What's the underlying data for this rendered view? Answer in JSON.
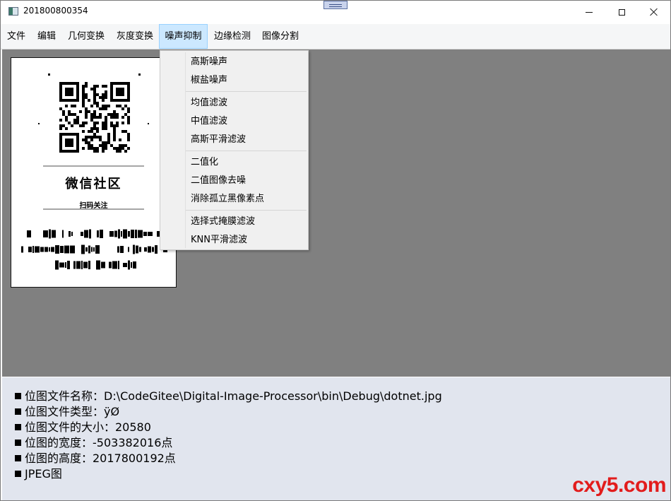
{
  "window": {
    "title": "201800800354"
  },
  "menubar": {
    "items": [
      {
        "label": "文件"
      },
      {
        "label": "编辑"
      },
      {
        "label": "几何变换"
      },
      {
        "label": "灰度变换"
      },
      {
        "label": "噪声抑制"
      },
      {
        "label": "边缘检测"
      },
      {
        "label": "图像分割"
      }
    ],
    "active": "噪声抑制"
  },
  "dropdown": {
    "items": [
      {
        "label": "高斯噪声"
      },
      {
        "label": "椒盐噪声"
      },
      {
        "label": "均值滤波"
      },
      {
        "label": "中值滤波"
      },
      {
        "label": "高斯平滑滤波"
      },
      {
        "label": "二值化"
      },
      {
        "label": "二值图像去噪"
      },
      {
        "label": "消除孤立黑像素点"
      },
      {
        "label": "选择式掩膜滤波"
      },
      {
        "label": "KNN平滑滤波"
      }
    ]
  },
  "image": {
    "caption_main": "微信社区",
    "caption_sub": "扫码关注"
  },
  "info": {
    "lines": [
      "位图文件名称：D:\\CodeGitee\\Digital-Image-Processor\\bin\\Debug\\dotnet.jpg",
      "位图文件类型：ÿØ",
      "位图文件的大小：20580",
      "位图的宽度：-503382016点",
      "位图的高度：2017800192点",
      "JPEG图"
    ]
  },
  "watermark": "cxy5.com",
  "colors": {
    "canvas_bg": "#808080",
    "info_bg": "#e1e5ee",
    "menu_active_bg": "#cce8ff",
    "watermark": "#e21c1c"
  }
}
